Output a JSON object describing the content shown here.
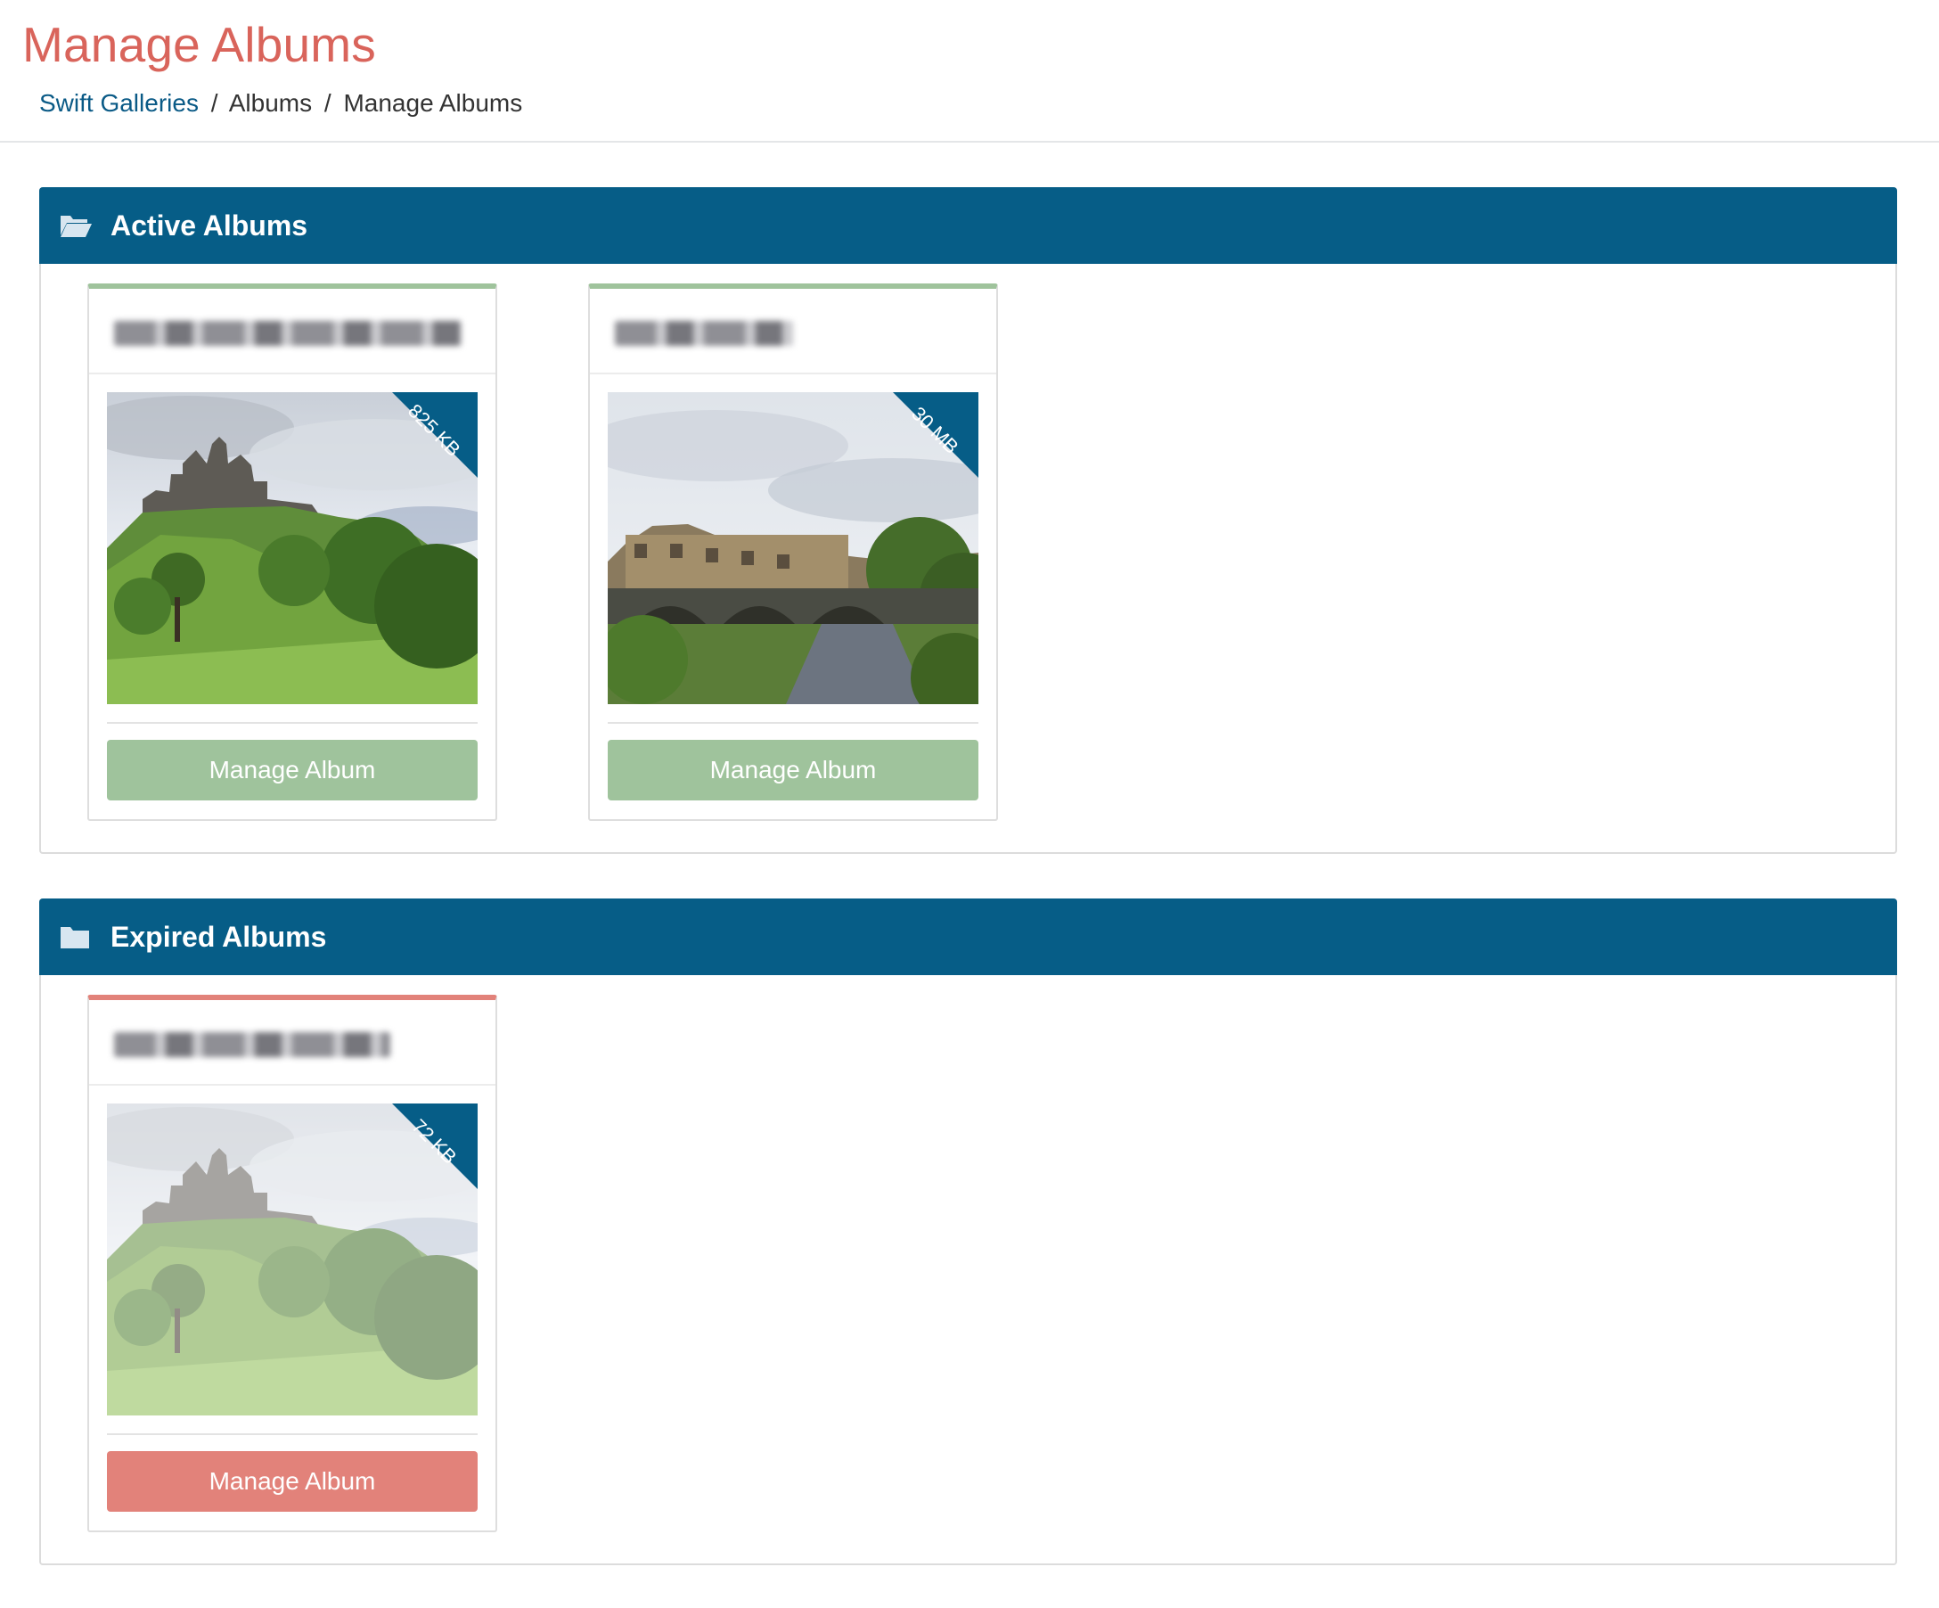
{
  "colors": {
    "title": "#d9645b",
    "link": "#0a5a86",
    "panel_heading": "#065d87",
    "active_accent": "#9fc39c",
    "expired_accent": "#e2827a",
    "badge": "#065d87"
  },
  "page": {
    "title": "Manage Albums",
    "breadcrumb": {
      "home": "Swift Galleries",
      "sep": "/",
      "albums": "Albums",
      "current": "Manage Albums"
    }
  },
  "active": {
    "heading": "Active Albums",
    "icon": "folder-open-icon",
    "albums": [
      {
        "size": "825 KB",
        "button": "Manage Album",
        "image": "castle-on-hill-photo"
      },
      {
        "size": "30 MB",
        "button": "Manage Album",
        "image": "stone-bridge-village-photo"
      }
    ]
  },
  "expired": {
    "heading": "Expired Albums",
    "icon": "folder-closed-icon",
    "albums": [
      {
        "size": "72 KB",
        "button": "Manage Album",
        "image": "castle-on-hill-photo"
      }
    ]
  }
}
